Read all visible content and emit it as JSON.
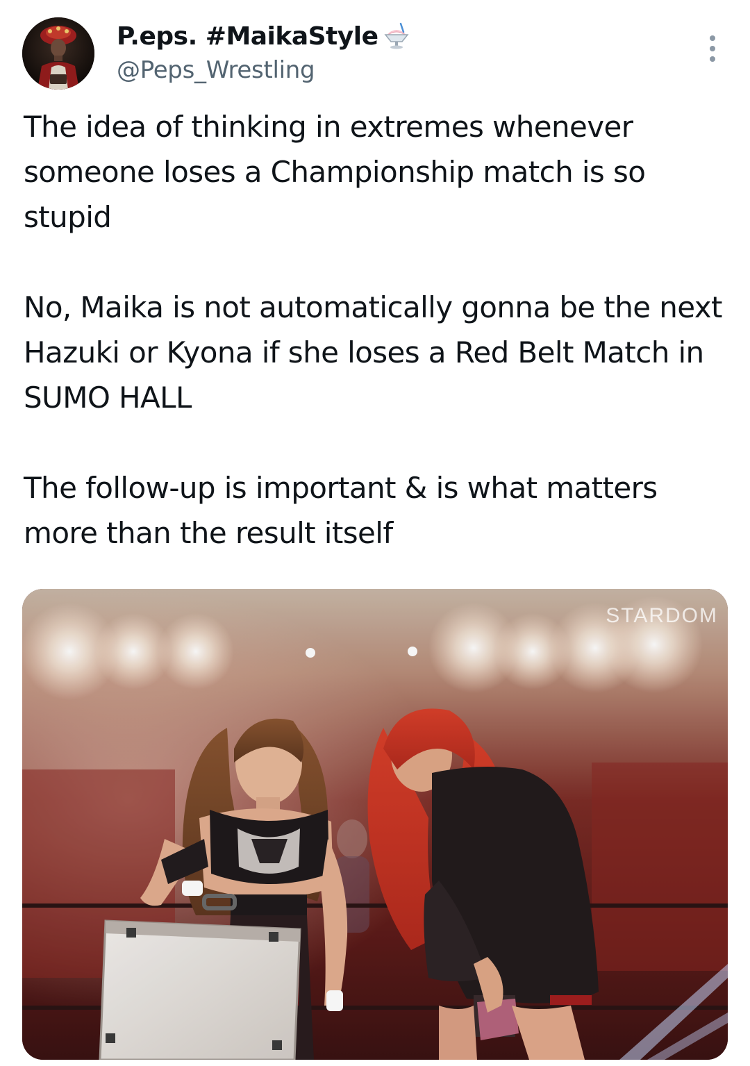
{
  "tweet": {
    "author": {
      "display_name": "P.eps. #MaikaStyle",
      "name_emoji": "shaved-ice-emoji",
      "handle": "@Peps_Wrestling",
      "avatar": "wrestler-avatar"
    },
    "more_icon": "more-options-icon",
    "text": "The idea of thinking in extremes whenever someone loses a Championship match is so stupid\n\nNo, Maika is not automatically gonna be the next Hazuki or Kyona if she loses a Red Belt Match in SUMO HALL\n\nThe follow-up is important & is what matters more than the result itself",
    "media": {
      "watermark": "STARDOM",
      "image": "wrestling-ring-photo"
    }
  },
  "colors": {
    "text_primary": "#0f1419",
    "text_secondary": "#536471",
    "background": "#ffffff"
  }
}
